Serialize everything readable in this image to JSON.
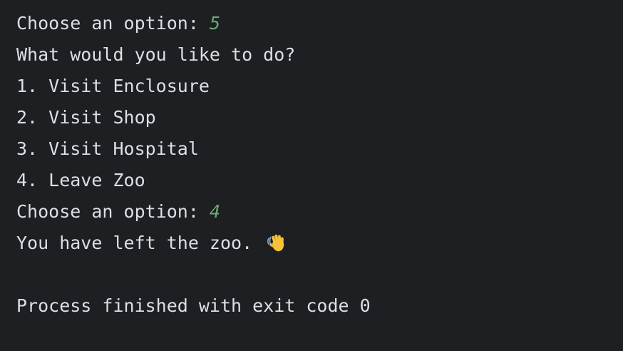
{
  "console": {
    "line1": {
      "prompt": "Choose an option: ",
      "input": "5"
    },
    "line2": "What would you like to do?",
    "menu": [
      "1. Visit Enclosure",
      "2. Visit Shop",
      "3. Visit Hospital",
      "4. Leave Zoo"
    ],
    "line7": {
      "prompt": "Choose an option: ",
      "input": "4"
    },
    "line8": {
      "text": "You have left the zoo. ",
      "icon": "waving-hand-icon"
    },
    "exit_message": "Process finished with exit code 0"
  },
  "colors": {
    "background": "#1e1f22",
    "text": "#dcdfe4",
    "user_input": "#6aab73"
  }
}
